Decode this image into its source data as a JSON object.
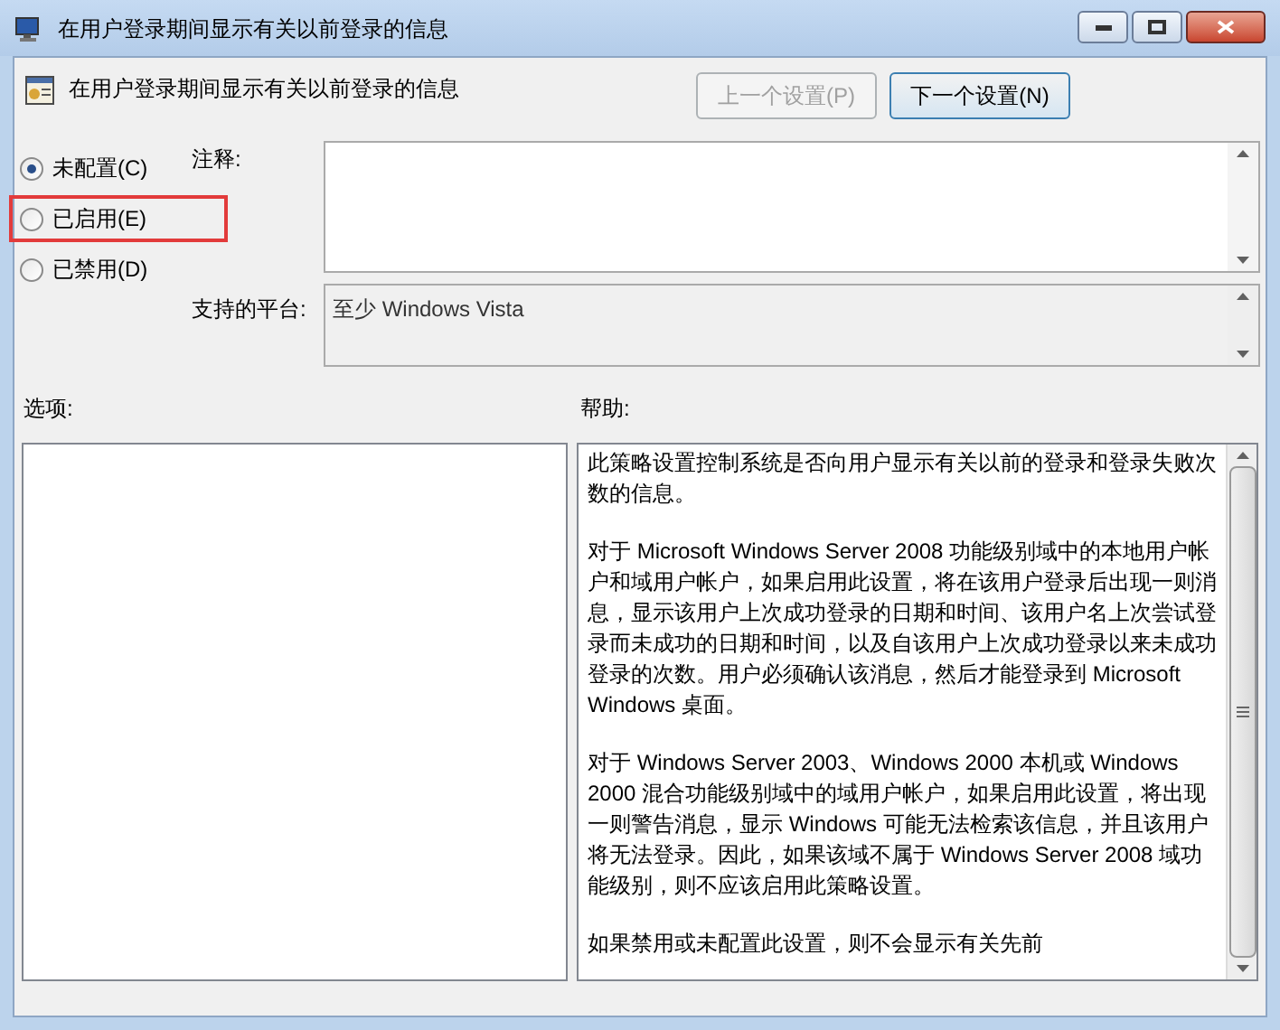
{
  "window": {
    "title": "在用户登录期间显示有关以前登录的信息"
  },
  "header": {
    "title": "在用户登录期间显示有关以前登录的信息"
  },
  "nav_buttons": [
    {
      "label": "上一个设置(P)",
      "disabled": true
    },
    {
      "label": "下一个设置(N)",
      "disabled": false
    }
  ],
  "options": [
    {
      "label": "未配置(C)",
      "selected": true,
      "highlighted": false
    },
    {
      "label": "已启用(E)",
      "selected": false,
      "highlighted": true
    },
    {
      "label": "已禁用(D)",
      "selected": false,
      "highlighted": false
    }
  ],
  "comment": {
    "label": "注释:"
  },
  "platform": {
    "label": "支持的平台:",
    "value": "至少 Windows Vista"
  },
  "options_panel": {
    "label": "选项:"
  },
  "help": {
    "label": "帮助:",
    "paragraphs": [
      "此策略设置控制系统是否向用户显示有关以前的登录和登录失败次数的信息。",
      "对于 Microsoft Windows Server 2008 功能级别域中的本地用户帐户和域用户帐户，如果启用此设置，将在该用户登录后出现一则消息，显示该用户上次成功登录的日期和时间、该用户名上次尝试登录而未成功的日期和时间，以及自该用户上次成功登录以来未成功登录的次数。用户必须确认该消息，然后才能登录到 Microsoft Windows 桌面。",
      "对于 Windows Server 2003、Windows 2000 本机或 Windows 2000 混合功能级别域中的域用户帐户，如果启用此设置，将出现一则警告消息，显示 Windows 可能无法检索该信息，并且该用户将无法登录。因此，如果该域不属于 Windows Server 2008 域功能级别，则不应该启用此策略设置。",
      "如果禁用或未配置此设置，则不会显示有关先前"
    ]
  }
}
